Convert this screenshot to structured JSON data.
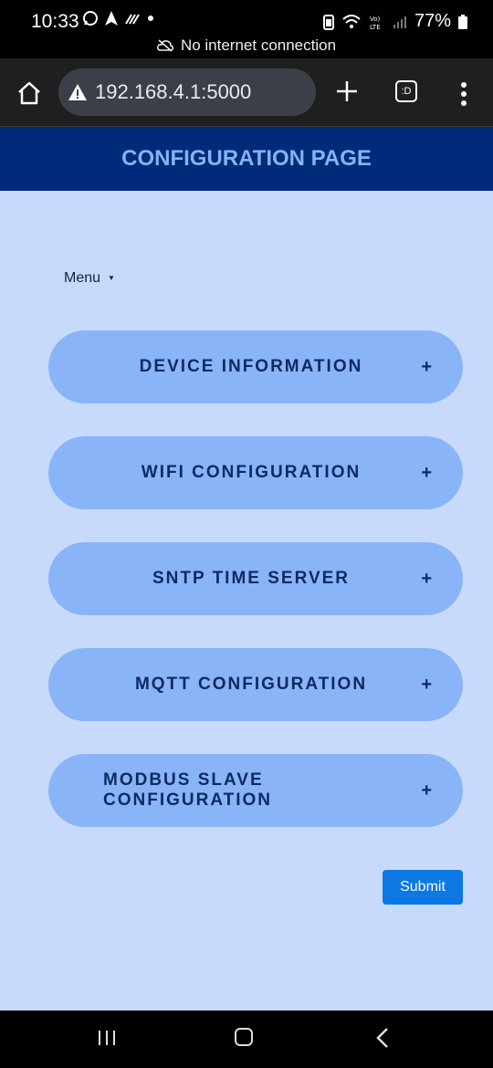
{
  "status_bar": {
    "time": "10:33",
    "battery": "77%",
    "network_message": "No internet connection",
    "icons": [
      "whatsapp-icon",
      "navigation-icon",
      "signal-icon",
      "dot-icon",
      "battery-saver-icon",
      "wifi-icon",
      "volte-icon",
      "cell-signal-icon",
      "battery-icon"
    ]
  },
  "browser": {
    "url": "192.168.4.1:5000",
    "tabs_label": ":D"
  },
  "page": {
    "title": "CONFIGURATION PAGE",
    "menu_label": "Menu",
    "sections": [
      {
        "label": "DEVICE INFORMATION",
        "toggle": "+"
      },
      {
        "label": "WIFI CONFIGURATION",
        "toggle": "+"
      },
      {
        "label": "SNTP TIME SERVER",
        "toggle": "+"
      },
      {
        "label": "MQTT CONFIGURATION",
        "toggle": "+"
      },
      {
        "label": "MODBUS SLAVE CONFIGURATION",
        "toggle": "+"
      }
    ],
    "submit_label": "Submit"
  },
  "colors": {
    "header_bg": "#002a7a",
    "header_text": "#82b4f5",
    "page_bg": "#c8dafb",
    "accordion_bg": "#8ab4f8",
    "accordion_text": "#0d2a62",
    "submit_bg": "#0b78e3"
  }
}
